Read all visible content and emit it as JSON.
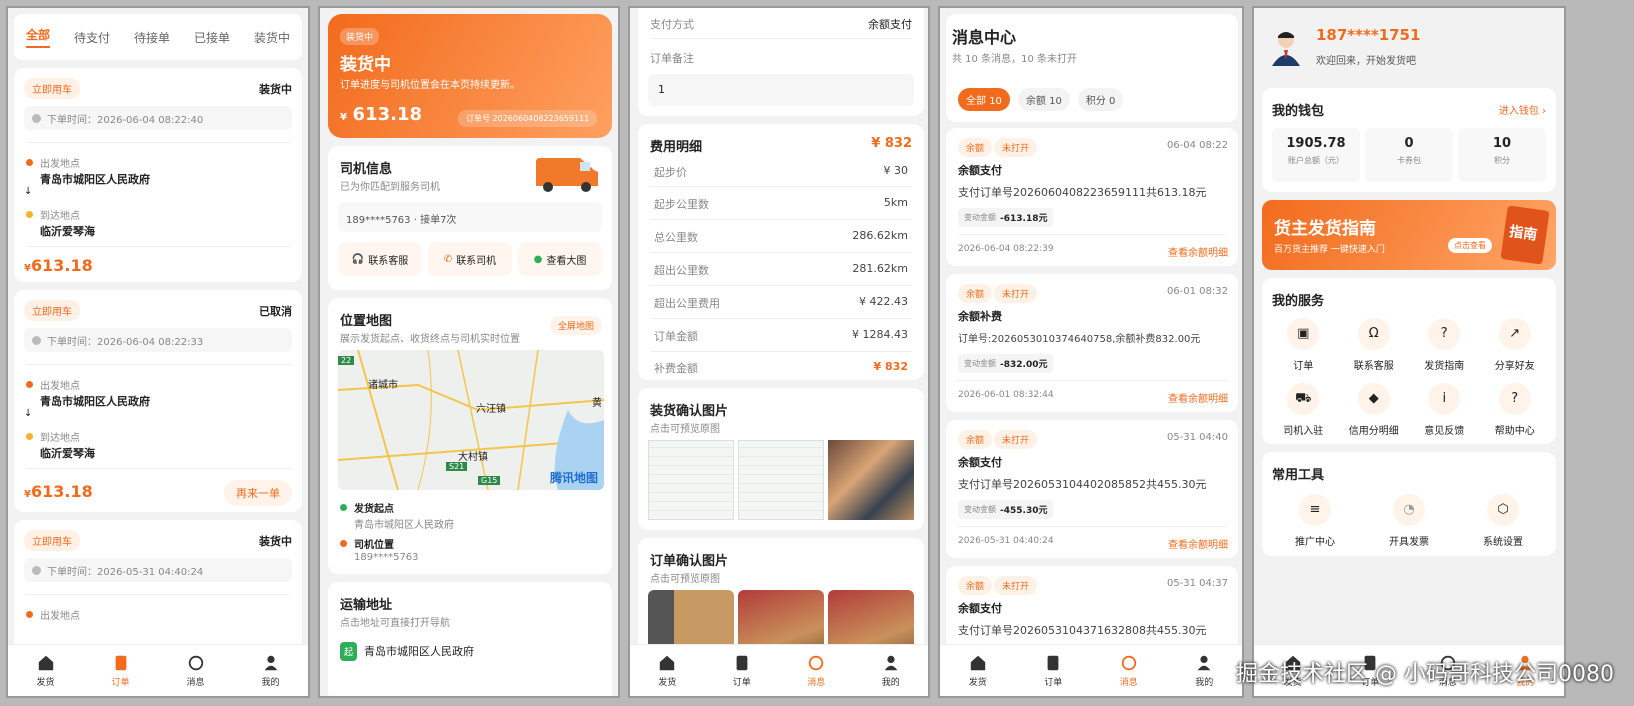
{
  "p1": {
    "tabs": [
      "全部",
      "待支付",
      "待接单",
      "已接单",
      "装货中"
    ],
    "orders": [
      {
        "tag": "立即用车",
        "status": "装货中",
        "time": "下单时间：2026-06-04 08:22:40",
        "from_label": "出发地点",
        "from": "青岛市城阳区人民政府",
        "to_label": "到达地点",
        "to": "临沂爱琴海",
        "price": "613.18",
        "currency": "¥",
        "action": ""
      },
      {
        "tag": "立即用车",
        "status": "已取消",
        "time": "下单时间：2026-06-04 08:22:33",
        "from_label": "出发地点",
        "from": "青岛市城阳区人民政府",
        "to_label": "到达地点",
        "to": "临沂爱琴海",
        "price": "613.18",
        "currency": "¥",
        "action": "再来一单"
      },
      {
        "tag": "立即用车",
        "status": "装货中",
        "time": "下单时间：2026-05-31 04:40:24",
        "from_label": "出发地点"
      }
    ],
    "tabbar": [
      "发货",
      "订单",
      "消息",
      "我的"
    ]
  },
  "p2": {
    "header": {
      "badge": "装货中",
      "title": "装货中",
      "subtitle": "订单进度与司机位置会在本页持续更新。",
      "currency": "¥",
      "price": "613.18",
      "order_no": "订单号 2026060408223659111"
    },
    "driver": {
      "title": "司机信息",
      "subtitle": "已为你匹配到服务司机",
      "info": "189****5763 · 接单7次",
      "buttons": [
        "联系客服",
        "联系司机",
        "查看大图"
      ]
    },
    "map": {
      "title": "位置地图",
      "subtitle": "展示发货起点、收货终点与司机实时位置",
      "fullscreen": "全屏地图",
      "labels": [
        "诸城市",
        "六汪镇",
        "大村镇",
        "黄",
        "S21",
        "G15",
        "22"
      ],
      "brand": "腾讯地图",
      "start_label": "发货起点",
      "start_value": "青岛市城阳区人民政府",
      "driver_label": "司机位置",
      "driver_value": "189****5763"
    },
    "transport": {
      "title": "运输地址",
      "subtitle": "点击地址可直接打开导航",
      "start_badge": "起",
      "start": "青岛市城阳区人民政府"
    }
  },
  "p3": {
    "pay_method_label": "支付方式",
    "pay_method": "余额支付",
    "remark_label": "订单备注",
    "remark": "1",
    "fee": {
      "title": "费用明细",
      "total": "¥ 832",
      "rows": [
        {
          "label": "起步价",
          "value": "¥ 30"
        },
        {
          "label": "起步公里数",
          "value": "5km"
        },
        {
          "label": "总公里数",
          "value": "286.62km"
        },
        {
          "label": "超出公里数",
          "value": "281.62km"
        },
        {
          "label": "超出公里费用",
          "value": "¥ 422.43"
        },
        {
          "label": "订单金额",
          "value": "¥ 1284.43"
        },
        {
          "label": "补费金额",
          "value": "¥ 832"
        }
      ]
    },
    "loading": {
      "title": "装货确认图片",
      "subtitle": "点击可预览原图"
    },
    "order_pics": {
      "title": "订单确认图片",
      "subtitle": "点击可预览原图"
    },
    "tabbar": [
      "发货",
      "订单",
      "消息",
      "我的"
    ]
  },
  "p4": {
    "title": "消息中心",
    "subtitle": "共 10 条消息，10 条未打开",
    "filters": [
      {
        "label": "全部",
        "count": "10"
      },
      {
        "label": "余额",
        "count": "10"
      },
      {
        "label": "积分",
        "count": "0"
      }
    ],
    "messages": [
      {
        "tag1": "余额",
        "tag2": "未打开",
        "time": "06-04 08:22",
        "title": "余额支付",
        "body": "支付订单号2026060408223659111共613.18元",
        "amount_label": "变动金额",
        "amount": "-613.18元",
        "date": "2026-06-04 08:22:39",
        "link": "查看余额明细"
      },
      {
        "tag1": "余额",
        "tag2": "未打开",
        "time": "06-01 08:32",
        "title": "余额补费",
        "body": "订单号:2026053010374640758,余额补费832.00元",
        "amount_label": "变动金额",
        "amount": "-832.00元",
        "date": "2026-06-01 08:32:44",
        "link": "查看余额明细"
      },
      {
        "tag1": "余额",
        "tag2": "未打开",
        "time": "05-31 04:40",
        "title": "余额支付",
        "body": "支付订单号2026053104402085852共455.30元",
        "amount_label": "变动金额",
        "amount": "-455.30元",
        "date": "2026-05-31 04:40:24",
        "link": "查看余额明细"
      },
      {
        "tag1": "余额",
        "tag2": "未打开",
        "time": "05-31 04:37",
        "title": "余额支付",
        "body": "支付订单号2026053104371632808共455.30元"
      }
    ],
    "tabbar": [
      "发货",
      "订单",
      "消息",
      "我的"
    ]
  },
  "p5": {
    "phone": "187****1751",
    "welcome": "欢迎回来，开始发货吧",
    "wallet": {
      "title": "我的钱包",
      "link": "进入钱包",
      "items": [
        {
          "value": "1905.78",
          "label": "账户总额（元）"
        },
        {
          "value": "0",
          "label": "卡券包"
        },
        {
          "value": "10",
          "label": "积分"
        }
      ]
    },
    "banner": {
      "title": "货主发货指南",
      "subtitle": "百万货主推荐 一键快速入门",
      "button": "点击查看",
      "book": "指南"
    },
    "services": {
      "title": "我的服务",
      "items": [
        "订单",
        "联系客服",
        "发货指南",
        "分享好友",
        "司机入驻",
        "信用分明细",
        "意见反馈",
        "帮助中心"
      ]
    },
    "tools": {
      "title": "常用工具",
      "items": [
        "推广中心",
        "开具发票",
        "系统设置"
      ]
    },
    "tabbar": [
      "发货",
      "订单",
      "消息",
      "我的"
    ]
  },
  "watermark": "掘金技术社区 @ 小码哥科技公司0080",
  "colors": {
    "accent": "#f26b1d",
    "background": "#f2f2f2"
  }
}
